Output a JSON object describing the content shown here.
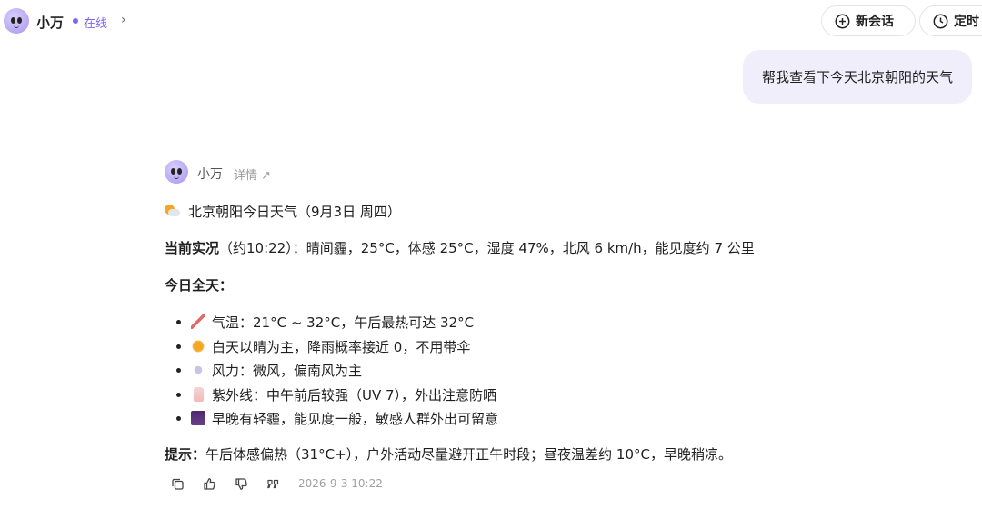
{
  "header": {
    "bot_name": "小万",
    "status": "在线",
    "chevron": "›",
    "new_chat_label": "新会话",
    "timer_label": "定时"
  },
  "user_message": "帮我查看下今天北京朝阳的天气",
  "assistant": {
    "name": "小万",
    "detail_link": "详情 ↗",
    "title": "北京朝阳今日天气（9月3日 周四）",
    "current_label": "当前实况",
    "current_text": "（约10:22）：晴间霾，25°C，体感 25°C，湿度 47%，北风 6 km/h，能见度约 7 公里",
    "allday_label": "今日全天：",
    "bullets": [
      {
        "icon": "thermometer-icon",
        "text": "气温：21°C ~ 32°C，午后最热可达 32°C"
      },
      {
        "icon": "sun-icon",
        "text": "白天以晴为主，降雨概率接近 0，不用带伞"
      },
      {
        "icon": "wind-icon",
        "text": "风力：微风，偏南风为主"
      },
      {
        "icon": "sunscreen-icon",
        "text": "紫外线：中午前后较强（UV 7），外出注意防晒"
      },
      {
        "icon": "fog-icon",
        "text": "早晚有轻霾，能见度一般，敏感人群外出可留意"
      }
    ],
    "tip_label": "提示：",
    "tip_text": "午后体感偏热（31°C+），户外活动尽量避开正午时段；昼夜温差约 10°C，早晚稍凉。",
    "timestamp": "2026-9-3 10:22"
  },
  "colors": {
    "accent": "#7b68ee",
    "bubble": "#f0eefb"
  }
}
